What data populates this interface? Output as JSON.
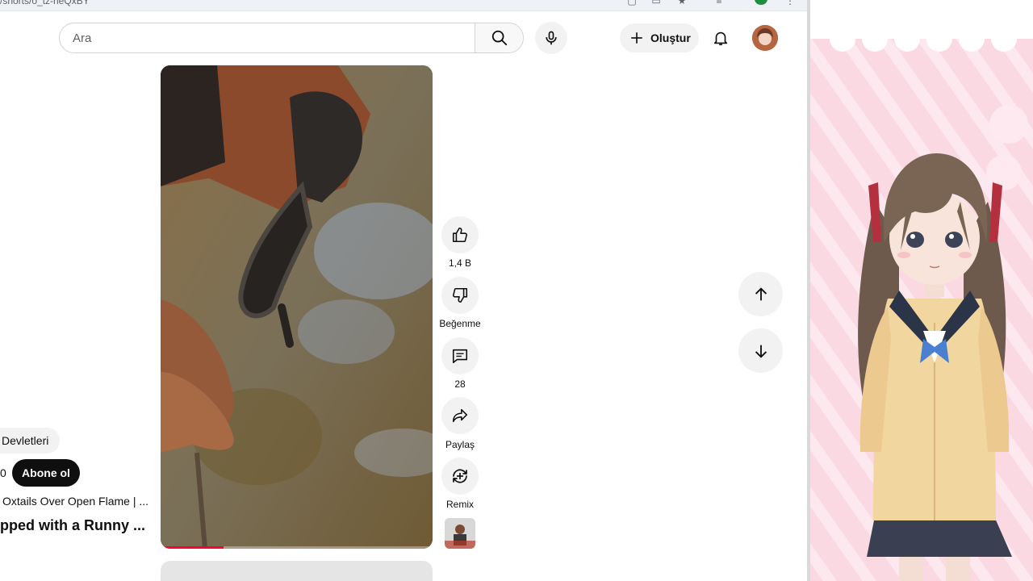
{
  "browser": {
    "url_fragment": "/shorts/o_tz-rieQxBY"
  },
  "header": {
    "search_placeholder": "Ara",
    "create_label": "Oluştur"
  },
  "video": {
    "progress_fraction": 0.23
  },
  "actions": {
    "like_count": "1,4 B",
    "dislike_label": "Beğenme",
    "comments_count": "28",
    "share_label": "Paylaş",
    "remix_label": "Remix"
  },
  "info": {
    "chip_label": "Devletleri",
    "subscriber_count_tail": "0",
    "subscribe_label": "Abone ol",
    "channel_subtitle": "Oxtails Over Open Flame | ...",
    "title": "pped with a Runny ..."
  },
  "colors": {
    "accent_red": "#ff0033",
    "subscribe_bg": "#0f0f0f",
    "chip_bg": "#f2f2f2",
    "panel_pink": "#fbd9e2"
  },
  "icons": [
    "search-icon",
    "mic-icon",
    "plus-icon",
    "bell-icon",
    "thumbs-up-icon",
    "thumbs-down-icon",
    "comment-icon",
    "share-icon",
    "remix-icon",
    "arrow-up-icon",
    "arrow-down-icon"
  ]
}
